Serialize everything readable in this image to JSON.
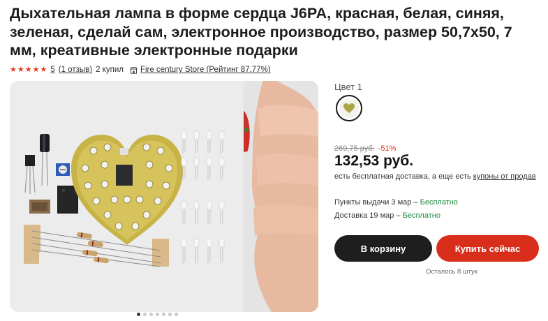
{
  "product": {
    "title": "Дыхательная лампа в форме сердца J6PA, красная, белая, синяя, зеленая, сделай сам, электронное производство, размер 50,7x50, 7 мм, креативные электронные подарки",
    "rating": "5",
    "reviews": "(1 отзыв)",
    "purchases": "2 купил",
    "store": "Fire century Store (Рейтинг 87.77%)"
  },
  "gallery": {
    "dots_total": 7,
    "active_dot": 0
  },
  "variant": {
    "label": "Цвет 1"
  },
  "pricing": {
    "old_price": "269,75 руб.",
    "discount": "-51%",
    "price": "132,53 руб.",
    "delivery_note_prefix": "есть бесплатная доставка, а еще есть ",
    "delivery_note_link": "купоны от продав"
  },
  "shipping": {
    "pickup_label": "Пункты выдачи 3 мар – ",
    "pickup_free": "Бесплатно",
    "delivery_label": "Доставка 19 мар – ",
    "delivery_free": "Бесплатно"
  },
  "actions": {
    "cart": "В корзину",
    "buy": "Купить сейчас",
    "stock": "Осталось 8 штук"
  },
  "colors": {
    "accent_red": "#d92e1c",
    "star": "#e6361f",
    "free_green": "#1f8a3e",
    "cart_button": "#1e1e1e"
  },
  "icons": [
    "star-icon",
    "store-icon",
    "heart-pcb-thumbnail"
  ]
}
